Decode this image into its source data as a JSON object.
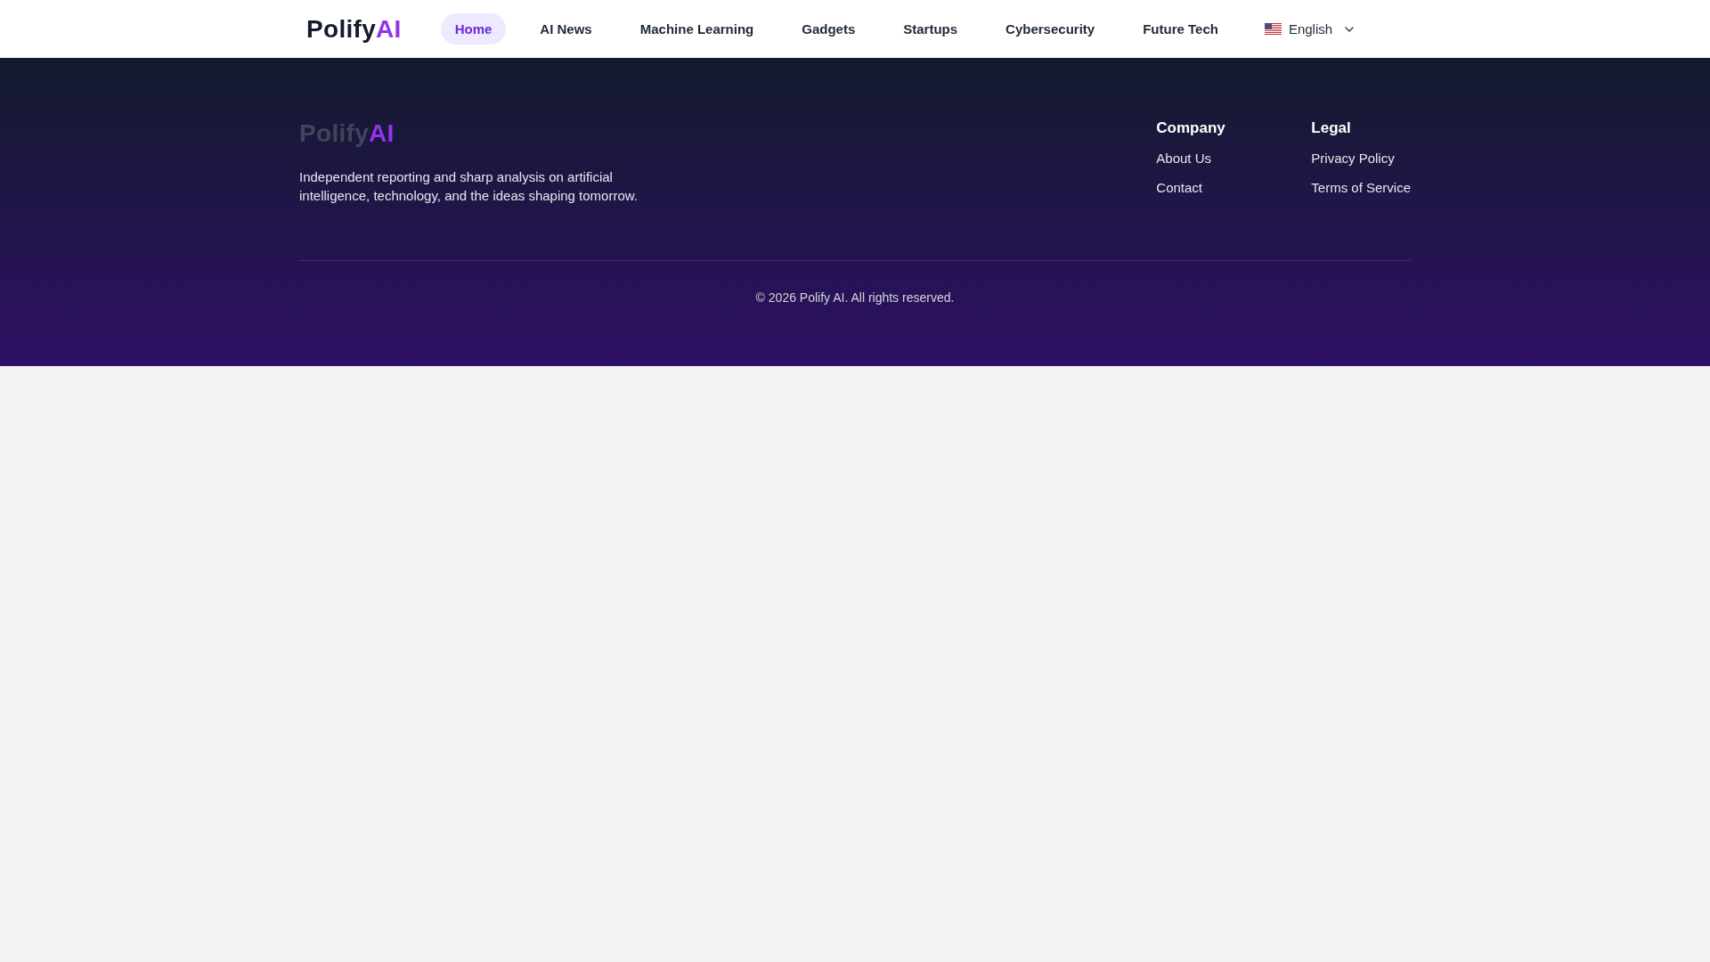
{
  "header": {
    "logo": {
      "text": "Polify",
      "accent": "AI"
    },
    "nav": [
      {
        "label": "Home",
        "selected": true
      },
      {
        "label": "AI News",
        "selected": false
      },
      {
        "label": "Machine Learning",
        "selected": false
      },
      {
        "label": "Gadgets",
        "selected": false
      },
      {
        "label": "Startups",
        "selected": false
      },
      {
        "label": "Cybersecurity",
        "selected": false
      },
      {
        "label": "Future Tech",
        "selected": false
      }
    ],
    "language": {
      "label": "English"
    }
  },
  "footer": {
    "logo": {
      "text": "Polify",
      "accent": "AI"
    },
    "description": "Independent reporting and sharp analysis on artificial intelligence, technology, and the ideas shaping tomorrow.",
    "columns": [
      {
        "heading": "Company",
        "links": [
          "About Us",
          "Contact"
        ]
      },
      {
        "heading": "Legal",
        "links": [
          "Privacy Policy",
          "Terms of Service"
        ]
      }
    ],
    "copyright": "© 2026 Polify AI. All rights reserved."
  }
}
